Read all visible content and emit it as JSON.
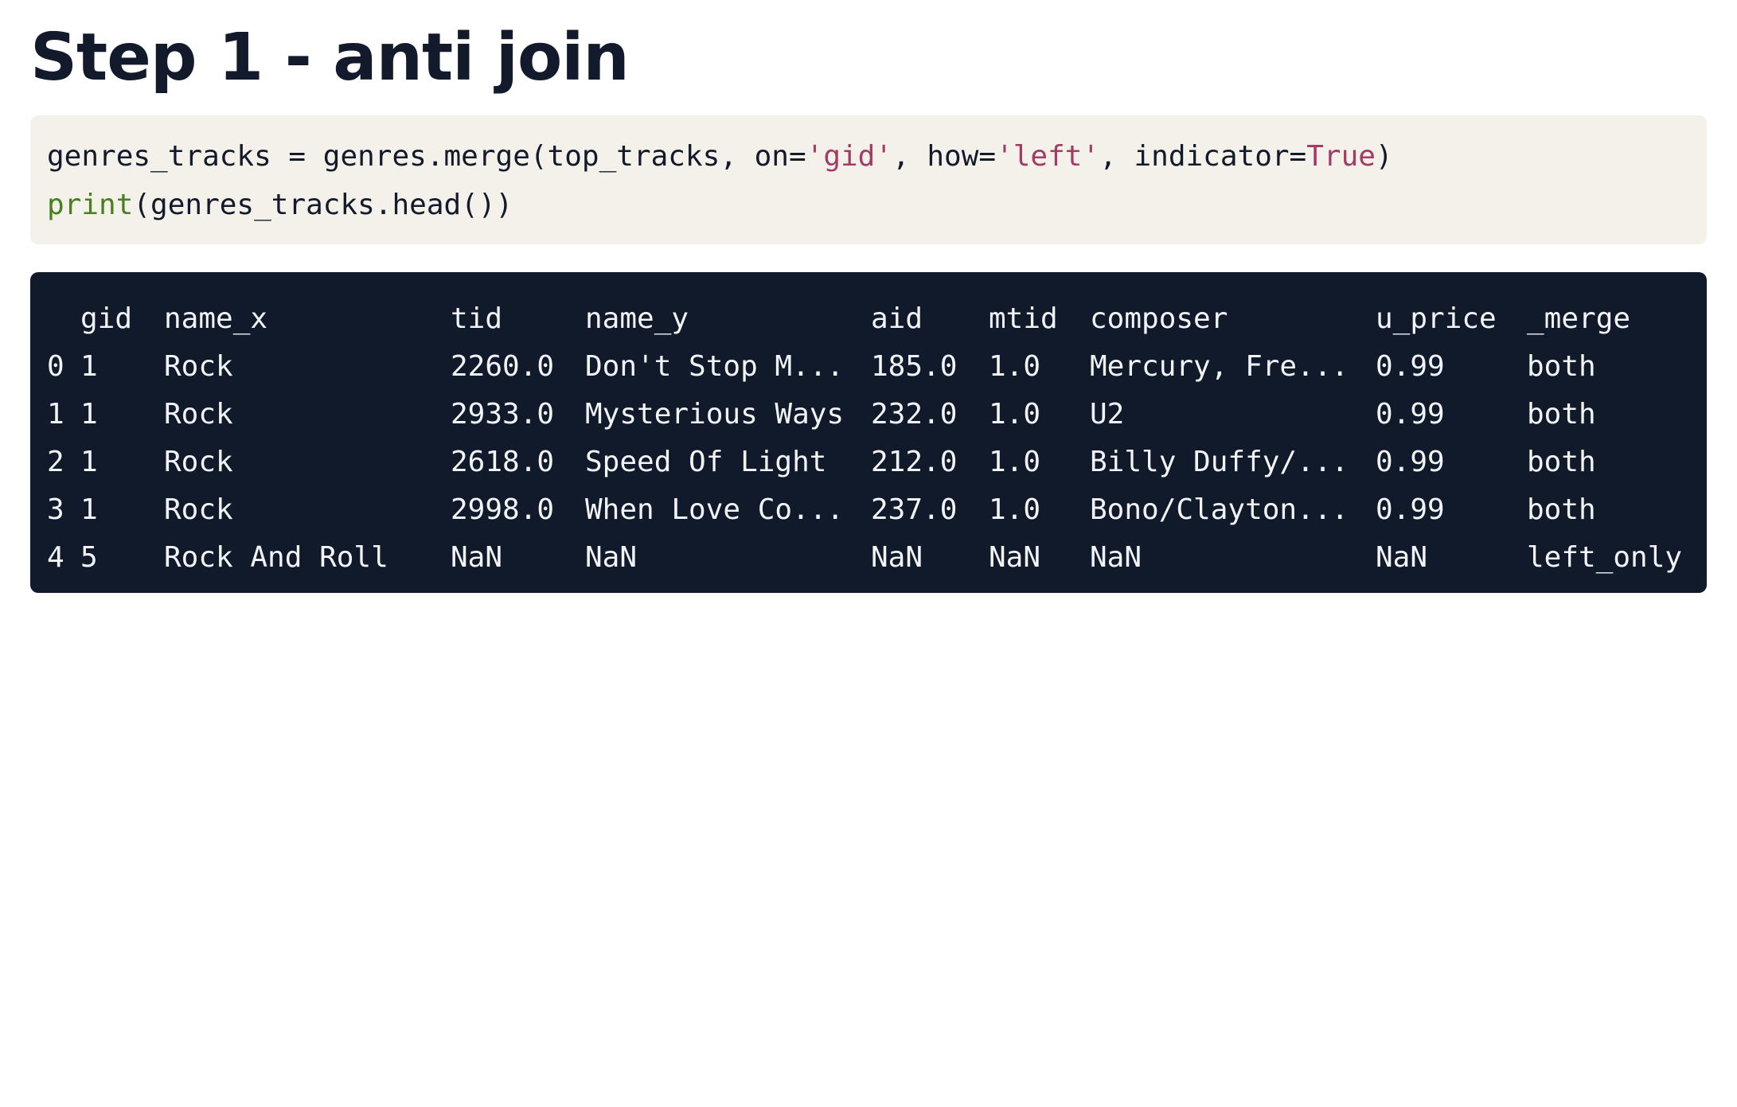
{
  "page": {
    "title": "Step 1 - anti join"
  },
  "code": {
    "line1": {
      "prefix": "genres_tracks = genres.merge(top_tracks, on=",
      "on_value": "'gid'",
      "mid": ", how=",
      "how_value": "'left'",
      "mid2": ", indicator=",
      "indicator_value": "True",
      "suffix": ")"
    },
    "line2": {
      "func": "print",
      "args": "(genres_tracks.head())"
    }
  },
  "output": {
    "columns": [
      "",
      "gid",
      "name_x",
      "tid",
      "name_y",
      "aid",
      "mtid",
      "composer",
      "u_price",
      "_merge"
    ],
    "rows": [
      [
        "0",
        "1",
        "Rock",
        "2260.0",
        "Don't Stop M...",
        "185.0",
        "1.0",
        "Mercury, Fre...",
        "0.99",
        "both"
      ],
      [
        "1",
        "1",
        "Rock",
        "2933.0",
        "Mysterious Ways",
        "232.0",
        "1.0",
        "U2",
        "0.99",
        "both"
      ],
      [
        "2",
        "1",
        "Rock",
        "2618.0",
        "Speed Of Light",
        "212.0",
        "1.0",
        "Billy Duffy/...",
        "0.99",
        "both"
      ],
      [
        "3",
        "1",
        "Rock",
        "2998.0",
        "When Love Co...",
        "237.0",
        "1.0",
        "Bono/Clayton...",
        "0.99",
        "both"
      ],
      [
        "4",
        "5",
        "Rock And Roll",
        "NaN",
        "NaN",
        "NaN",
        "NaN",
        "NaN",
        "NaN",
        "left_only"
      ]
    ]
  }
}
